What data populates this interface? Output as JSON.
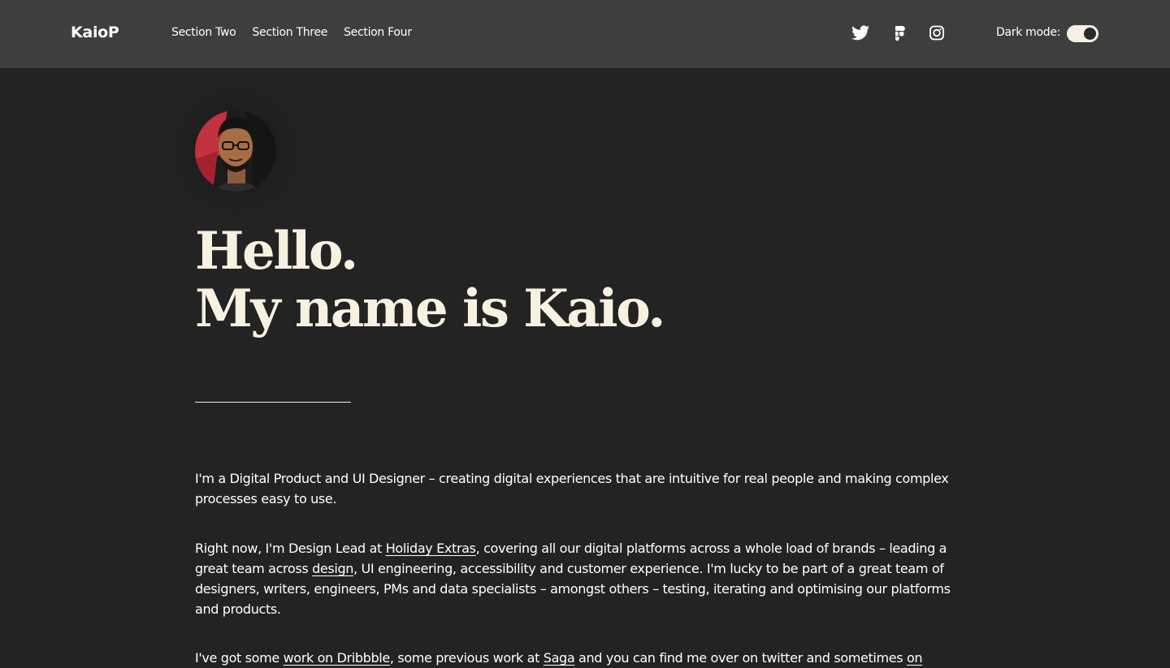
{
  "header": {
    "logo": "KaioP",
    "nav": [
      "Section Two",
      "Section Three",
      "Section Four"
    ],
    "social_icons": [
      "twitter-icon",
      "figma-icon",
      "instagram-icon"
    ],
    "dark_mode_label": "Dark mode:",
    "dark_mode_on": true
  },
  "hero": {
    "line1": "Hello.",
    "line2": "My name is Kaio."
  },
  "intro": {
    "p1": "I'm a Digital Product and UI Designer – creating digital experiences that are intuitive for real people and making complex processes easy to use.",
    "p2": {
      "t1": "Right now, I'm Design Lead at ",
      "link1": "Holiday Extras",
      "t2": ", covering all our digital platforms across a whole load of brands – leading a great team across ",
      "link2": "design",
      "t3": ", UI engineering, accessibility and customer experience. I'm lucky to be part of a great team of designers, writers, engineers, PMs and data specialists – amongst others – testing, iterating and optimising our platforms and products."
    },
    "p3": {
      "t1": "I've got some ",
      "link1": "work on Dribbble",
      "t2": ", some previous work at ",
      "link2": "Saga",
      "t3": " and you can find me over on twitter and sometimes ",
      "link3": "on"
    }
  },
  "colors": {
    "page_background": "#232323",
    "header_background": "#3e3e3e",
    "headline": "#f7f1e0",
    "text": "#ffffff"
  }
}
